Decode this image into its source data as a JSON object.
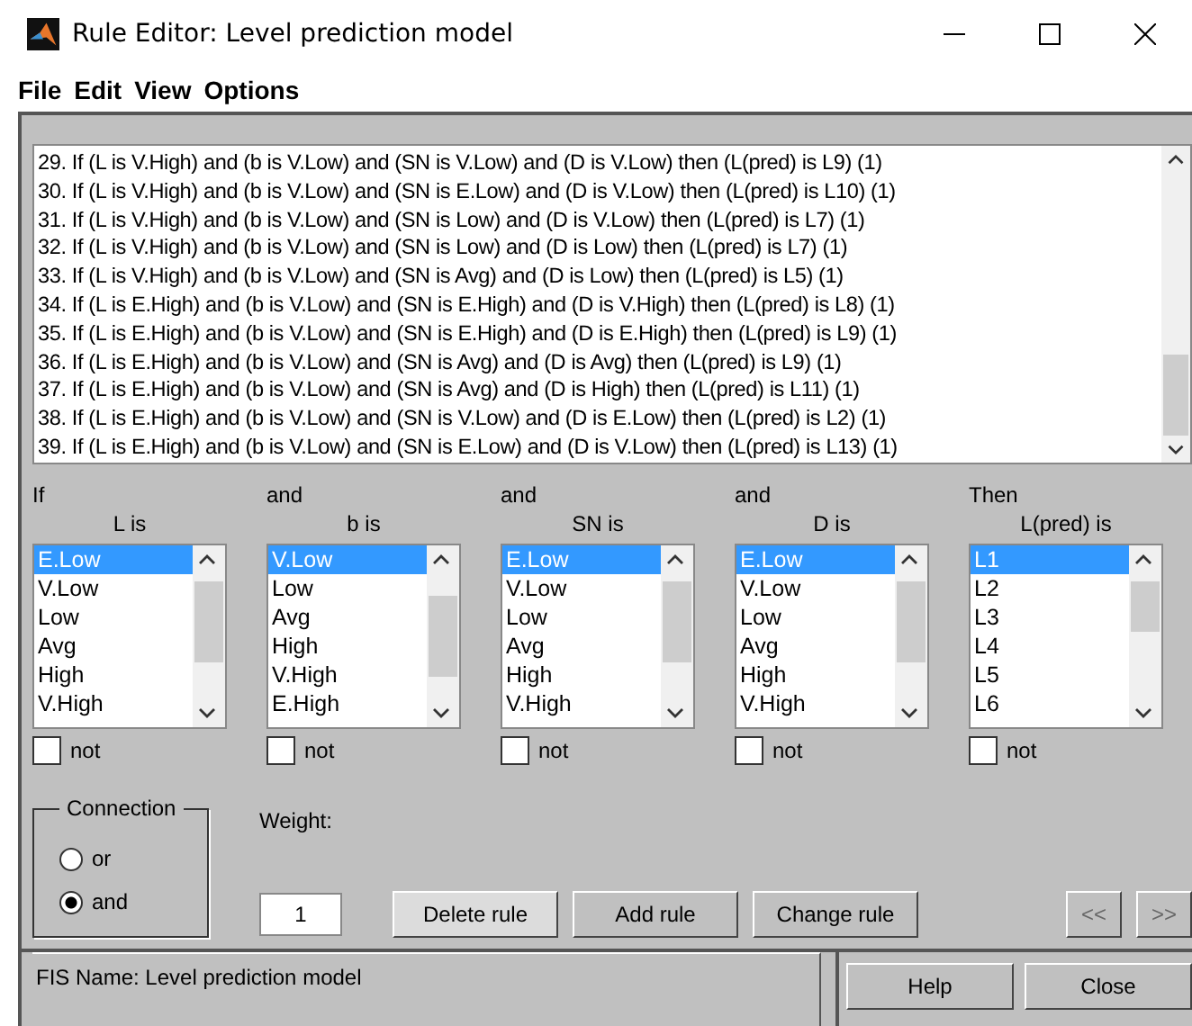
{
  "window": {
    "title": "Rule Editor: Level prediction model"
  },
  "menu": [
    "File",
    "Edit",
    "View",
    "Options"
  ],
  "rules": [
    "29. If (L is V.High) and (b is V.Low) and (SN is V.Low) and (D is V.Low) then (L(pred) is L9) (1)",
    "30. If (L is V.High) and (b is V.Low) and (SN is E.Low) and (D is V.Low) then (L(pred) is L10) (1)",
    "31. If (L is V.High) and (b is V.Low) and (SN is Low) and (D is V.Low) then (L(pred) is L7) (1)",
    "32. If (L is V.High) and (b is V.Low) and (SN is Low) and (D is Low) then (L(pred) is L7) (1)",
    "33. If (L is V.High) and (b is V.Low) and (SN is Avg) and (D is Low) then (L(pred) is L5) (1)",
    "34. If (L is E.High) and (b is V.Low) and (SN is E.High) and (D is V.High) then (L(pred) is L8) (1)",
    "35. If (L is E.High) and (b is V.Low) and (SN is E.High) and (D is E.High) then (L(pred) is L9) (1)",
    "36. If (L is E.High) and (b is V.Low) and (SN is Avg) and (D is Avg) then (L(pred) is L9) (1)",
    "37. If (L is E.High) and (b is V.Low) and (SN is Avg) and (D is High) then (L(pred) is L11) (1)",
    "38. If (L is E.High) and (b is V.Low) and (SN is V.Low) and (D is E.Low) then (L(pred) is L2) (1)",
    "39. If (L is E.High) and (b is V.Low) and (SN is E.Low) and (D is V.Low) then (L(pred) is L13) (1)"
  ],
  "columns": [
    {
      "connector": "If",
      "label": "L is",
      "items": [
        {
          "label": "E.Low",
          "selected": true
        },
        {
          "label": "V.Low",
          "selected": false
        },
        {
          "label": "Low",
          "selected": false
        },
        {
          "label": "Avg",
          "selected": false
        },
        {
          "label": "High",
          "selected": false
        },
        {
          "label": "V.High",
          "selected": false
        }
      ],
      "not": {
        "label": "not",
        "checked": false
      }
    },
    {
      "connector": "and",
      "label": "b is",
      "items": [
        {
          "label": "V.Low",
          "selected": true
        },
        {
          "label": "Low",
          "selected": false
        },
        {
          "label": "Avg",
          "selected": false
        },
        {
          "label": "High",
          "selected": false
        },
        {
          "label": "V.High",
          "selected": false
        },
        {
          "label": "E.High",
          "selected": false
        }
      ],
      "not": {
        "label": "not",
        "checked": false
      }
    },
    {
      "connector": "and",
      "label": "SN is",
      "items": [
        {
          "label": "E.Low",
          "selected": true
        },
        {
          "label": "V.Low",
          "selected": false
        },
        {
          "label": "Low",
          "selected": false
        },
        {
          "label": "Avg",
          "selected": false
        },
        {
          "label": "High",
          "selected": false
        },
        {
          "label": "V.High",
          "selected": false
        }
      ],
      "not": {
        "label": "not",
        "checked": false
      }
    },
    {
      "connector": "and",
      "label": "D is",
      "items": [
        {
          "label": "E.Low",
          "selected": true
        },
        {
          "label": "V.Low",
          "selected": false
        },
        {
          "label": "Low",
          "selected": false
        },
        {
          "label": "Avg",
          "selected": false
        },
        {
          "label": "High",
          "selected": false
        },
        {
          "label": "V.High",
          "selected": false
        }
      ],
      "not": {
        "label": "not",
        "checked": false
      }
    },
    {
      "connector": "Then",
      "label": "L(pred) is",
      "items": [
        {
          "label": "L1",
          "selected": true
        },
        {
          "label": "L2",
          "selected": false
        },
        {
          "label": "L3",
          "selected": false
        },
        {
          "label": "L4",
          "selected": false
        },
        {
          "label": "L5",
          "selected": false
        },
        {
          "label": "L6",
          "selected": false
        }
      ],
      "not": {
        "label": "not",
        "checked": false
      }
    }
  ],
  "connection": {
    "title": "Connection",
    "options": [
      {
        "label": "or",
        "selected": false
      },
      {
        "label": "and",
        "selected": true
      }
    ]
  },
  "weight": {
    "label": "Weight:",
    "value": "1"
  },
  "actions": [
    {
      "label": "Delete rule",
      "focused": true
    },
    {
      "label": "Add rule",
      "focused": false
    },
    {
      "label": "Change rule",
      "focused": false
    }
  ],
  "nav": [
    {
      "label": "<<",
      "disabled": true
    },
    {
      "label": ">>",
      "disabled": true
    }
  ],
  "status": "FIS Name: Level prediction model",
  "footer_buttons": [
    "Help",
    "Close"
  ]
}
